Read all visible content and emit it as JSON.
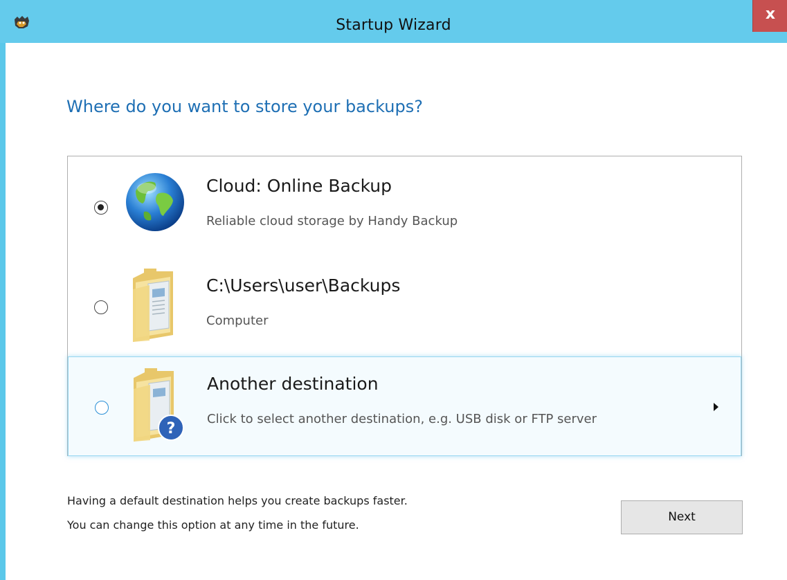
{
  "window": {
    "title": "Startup Wizard",
    "close_label": "x"
  },
  "heading": "Where do you want to store your backups?",
  "options": [
    {
      "title": "Cloud: Online Backup",
      "subtitle": "Reliable cloud storage by Handy Backup",
      "icon": "globe-icon",
      "selected": true
    },
    {
      "title": "C:\\Users\\user\\Backups",
      "subtitle": "Computer",
      "icon": "folder-icon",
      "selected": false
    },
    {
      "title": "Another destination",
      "subtitle": "Click to select another destination, e.g. USB disk or FTP server",
      "icon": "folder-question-icon",
      "selected": false,
      "has_submenu": true
    }
  ],
  "footer": {
    "line1": "Having a default destination helps you create backups faster.",
    "line2": "You can change this option at any time in the future.",
    "next_label": "Next"
  },
  "colors": {
    "titlebar": "#64cbec",
    "heading": "#1e6fb4",
    "close": "#c75050",
    "hover_border": "#96d6f0"
  }
}
